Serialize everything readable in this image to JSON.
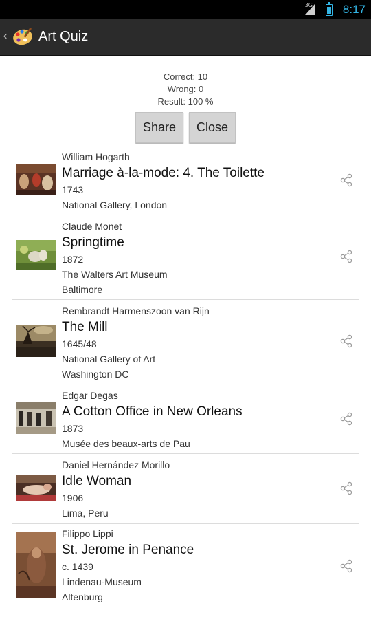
{
  "status_bar": {
    "network": "3G",
    "time": "8:17"
  },
  "action_bar": {
    "back_icon": "chevron-left-icon",
    "app_icon": "palette-icon",
    "title": "Art Quiz"
  },
  "summary": {
    "correct": "Correct: 10",
    "wrong": "Wrong: 0",
    "result": "Result: 100 %"
  },
  "buttons": {
    "share": "Share",
    "close": "Close"
  },
  "paintings": [
    {
      "artist": "William Hogarth",
      "title": "Marriage à-la-mode: 4. The Toilette",
      "meta": [
        "1743",
        "National Gallery, London"
      ]
    },
    {
      "artist": "Claude Monet",
      "title": "Springtime",
      "meta": [
        "1872",
        "The Walters Art Museum",
        "Baltimore"
      ]
    },
    {
      "artist": "Rembrandt Harmenszoon van Rijn",
      "title": "The Mill",
      "meta": [
        "1645/48",
        "National Gallery of Art",
        "Washington DC"
      ]
    },
    {
      "artist": "Edgar Degas",
      "title": "A Cotton Office in New Orleans",
      "meta": [
        "1873",
        "Musée des beaux-arts de Pau"
      ]
    },
    {
      "artist": "Daniel Hernández Morillo",
      "title": "Idle Woman",
      "meta": [
        "1906",
        "Lima, Peru"
      ]
    },
    {
      "artist": "Filippo Lippi",
      "title": "St. Jerome in Penance",
      "meta": [
        "c. 1439",
        "Lindenau-Museum",
        "Altenburg"
      ]
    }
  ]
}
